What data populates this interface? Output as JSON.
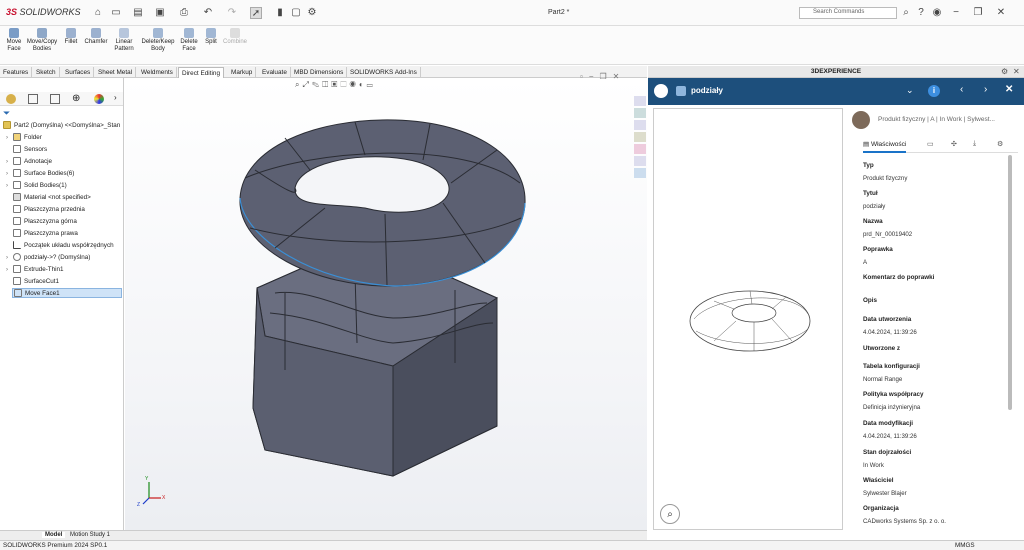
{
  "app": {
    "brand": "SOLIDWORKS",
    "document_title": "Part2 *",
    "search_placeholder": "Search Commands"
  },
  "ribbon": {
    "items": [
      {
        "label": "Move Face",
        "icon": "move-face-icon"
      },
      {
        "label": "Move/Copy Bodies",
        "icon": "move-copy-bodies-icon"
      },
      {
        "label": "Fillet",
        "icon": "fillet-icon"
      },
      {
        "label": "Chamfer",
        "icon": "chamfer-icon"
      },
      {
        "label": "Linear Pattern",
        "icon": "linear-pattern-icon"
      },
      {
        "label": "Delete/Keep Body",
        "icon": "delete-keep-body-icon"
      },
      {
        "label": "Delete Face",
        "icon": "delete-face-icon"
      },
      {
        "label": "Split",
        "icon": "split-icon"
      },
      {
        "label": "Combine",
        "icon": "combine-icon",
        "disabled": true
      }
    ]
  },
  "tabs": [
    "Features",
    "Sketch",
    "Surfaces",
    "Sheet Metal",
    "Weldments",
    "Direct Editing",
    "Markup",
    "Evaluate",
    "MBD Dimensions",
    "SOLIDWORKS Add-Ins"
  ],
  "active_tab": "Direct Editing",
  "tree": {
    "root": "Part2 (Domyślna) <<Domyślna>_Stan",
    "items": [
      "Folder",
      "Sensors",
      "Adnotacje",
      "Surface Bodies(6)",
      "Solid Bodies(1)",
      "Material <not specified>",
      "Płaszczyzna przednia",
      "Płaszczyzna górna",
      "Płaszczyzna prawa",
      "Początek układu współrzędnych",
      "podziały->? (Domyślna)",
      "Extrude-Thin1",
      "SurfaceCut1",
      "Move Face1"
    ]
  },
  "bottom_tabs": [
    "Model",
    "Motion Study 1"
  ],
  "status": {
    "left": "SOLIDWORKS Premium 2024 SP0.1",
    "units": "MMGS"
  },
  "triad": {
    "x": "X",
    "y": "Y",
    "z": "Z"
  },
  "experience": {
    "header": "3DEXPERIENCE",
    "object_name": "podziały",
    "subtitle": "Produkt fizyczny | A | In Work | Sylwest...",
    "properties_tab": "Właściwości",
    "properties": [
      {
        "label": "Typ",
        "value": "Produkt fizyczny"
      },
      {
        "label": "Tytuł",
        "value": "podziały"
      },
      {
        "label": "Nazwa",
        "value": "prd_Nr_00019402"
      },
      {
        "label": "Poprawka",
        "value": "A"
      },
      {
        "label": "Komentarz do poprawki",
        "value": ""
      },
      {
        "label": "Opis",
        "value": ""
      },
      {
        "label": "Data utworzenia",
        "value": "4.04.2024, 11:39:26"
      },
      {
        "label": "Utworzone z",
        "value": ""
      },
      {
        "label": "Tabela konfiguracji",
        "value": "Normal Range"
      },
      {
        "label": "Polityka współpracy",
        "value": "Definicja inżynieryjna"
      },
      {
        "label": "Data modyfikacji",
        "value": "4.04.2024, 11:39:26"
      },
      {
        "label": "Stan dojrzałości",
        "value": "In Work"
      },
      {
        "label": "Właściciel",
        "value": "Sylwester Blajer"
      },
      {
        "label": "Organizacja",
        "value": "CADworks Systems Sp. z o. o."
      }
    ]
  },
  "colors": {
    "brand": "#c8102e",
    "dx_bar": "#1d4f7c",
    "model": "#4d5161",
    "accent": "#1a73c8"
  }
}
